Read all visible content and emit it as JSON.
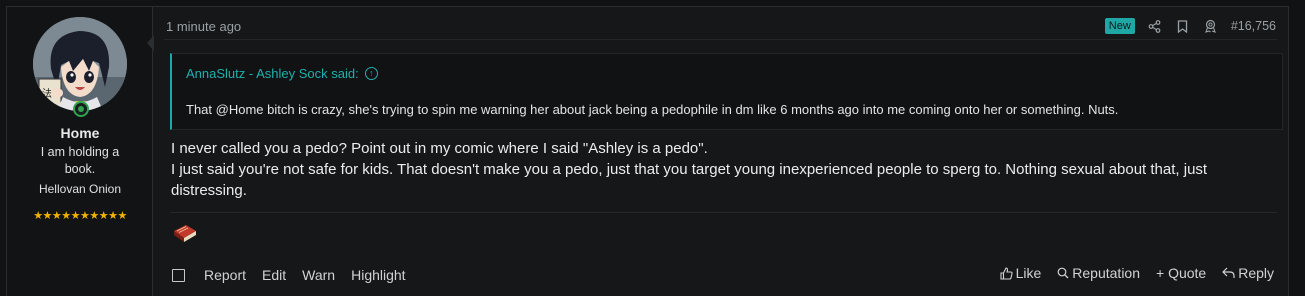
{
  "user": {
    "name": "Home",
    "title": "I am holding a book.",
    "banner": "Hellovan Onion",
    "stars": "★★★★★★★★★★",
    "avatar_icon": "anime-avatar",
    "online_icon": "online-status-icon"
  },
  "header": {
    "timestamp": "1 minute ago",
    "new_badge": "New",
    "share_icon": "share-icon",
    "bookmark_icon": "bookmark-icon",
    "award_icon": "award-icon",
    "post_number": "#16,756"
  },
  "quote": {
    "attribution": "AnnaSlutz - Ashley Sock said:",
    "text": "That @Home bitch is crazy, she's trying to spin me warning her about jack being a pedophile in dm like 6 months ago into me coming onto her or something. Nuts."
  },
  "body": {
    "lines": [
      "I never called you a pedo? Point out in my comic where I said \"Ashley is a pedo\".",
      "I just said you're not safe for kids. That doesn't make you a pedo, just that you target young inexperienced people to sperg to. Nothing sexual about that, just distressing."
    ]
  },
  "reaction_icon": "book-reaction-icon",
  "footer": {
    "report": "Report",
    "edit": "Edit",
    "warn": "Warn",
    "highlight": "Highlight",
    "like": "Like",
    "reputation": "Reputation",
    "quote": "+ Quote",
    "reply": "Reply"
  },
  "colors": {
    "accent": "#1fa7a6",
    "background": "#151719",
    "online": "#2ea44f",
    "stars": "#f0b400"
  }
}
